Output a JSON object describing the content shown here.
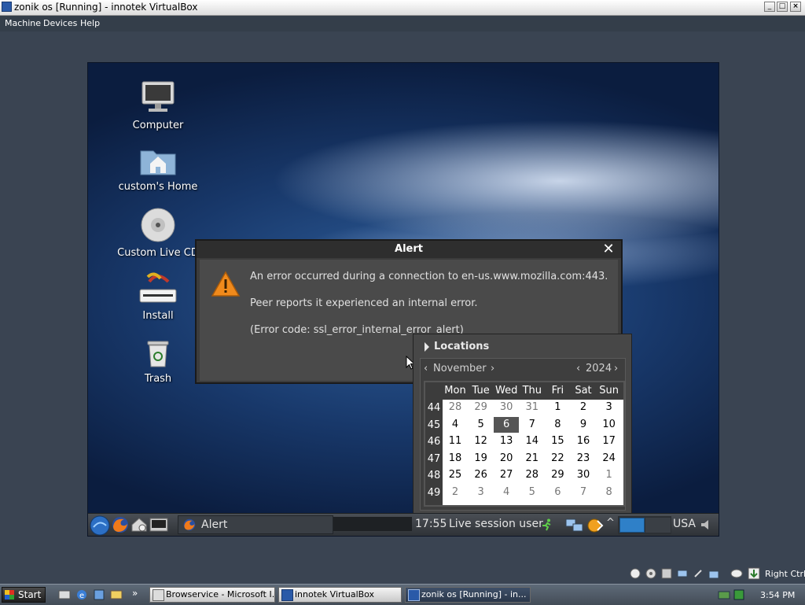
{
  "window": {
    "title": "zonik os [Running] - innotek VirtualBox"
  },
  "menubar": {
    "items": [
      "Machine",
      "Devices",
      "Help"
    ]
  },
  "desktop": {
    "icons": [
      {
        "label": "Computer"
      },
      {
        "label": "custom's Home"
      },
      {
        "label": "Custom Live CD"
      },
      {
        "label": "Install"
      },
      {
        "label": "Trash"
      }
    ]
  },
  "alert": {
    "title": "Alert",
    "close": "✕",
    "lines": [
      "An error occurred during a connection to en-us.www.mozilla.com:443.",
      "Peer reports it experienced an internal error.",
      "(Error code: ssl_error_internal_error_alert)"
    ]
  },
  "calendar": {
    "locations_label": "Locations",
    "month": "November",
    "year": "2024",
    "prev": "‹",
    "next": "›",
    "weekdays": [
      "Mon",
      "Tue",
      "Wed",
      "Thu",
      "Fri",
      "Sat",
      "Sun"
    ],
    "weeks": [
      {
        "num": "44",
        "days": [
          "28",
          "29",
          "30",
          "31",
          "1",
          "2",
          "3"
        ]
      },
      {
        "num": "45",
        "days": [
          "4",
          "5",
          "6",
          "7",
          "8",
          "9",
          "10"
        ]
      },
      {
        "num": "46",
        "days": [
          "11",
          "12",
          "13",
          "14",
          "15",
          "16",
          "17"
        ]
      },
      {
        "num": "47",
        "days": [
          "18",
          "19",
          "20",
          "21",
          "22",
          "23",
          "24"
        ]
      },
      {
        "num": "48",
        "days": [
          "25",
          "26",
          "27",
          "28",
          "29",
          "30",
          "1"
        ]
      },
      {
        "num": "49",
        "days": [
          "2",
          "3",
          "4",
          "5",
          "6",
          "7",
          "8"
        ]
      }
    ],
    "selected_day": "6"
  },
  "panel": {
    "task_label": "Alert",
    "clock": "17:55",
    "session": "Live session user",
    "keyboard": "USA"
  },
  "host_tray_row": {
    "label": "Right Ctrl"
  },
  "taskbar": {
    "start": "Start",
    "chevron": "»",
    "buttons": [
      {
        "label": "Browservice - Microsoft I..."
      },
      {
        "label": "innotek VirtualBox"
      },
      {
        "label": "zonik os [Running] - in..."
      }
    ],
    "clock": "3:54 PM"
  },
  "colors": {
    "accent": "#2f5f9c",
    "panel": "#3a3f45",
    "dialog": "#4a4a4a",
    "selected_day": "#555555"
  }
}
